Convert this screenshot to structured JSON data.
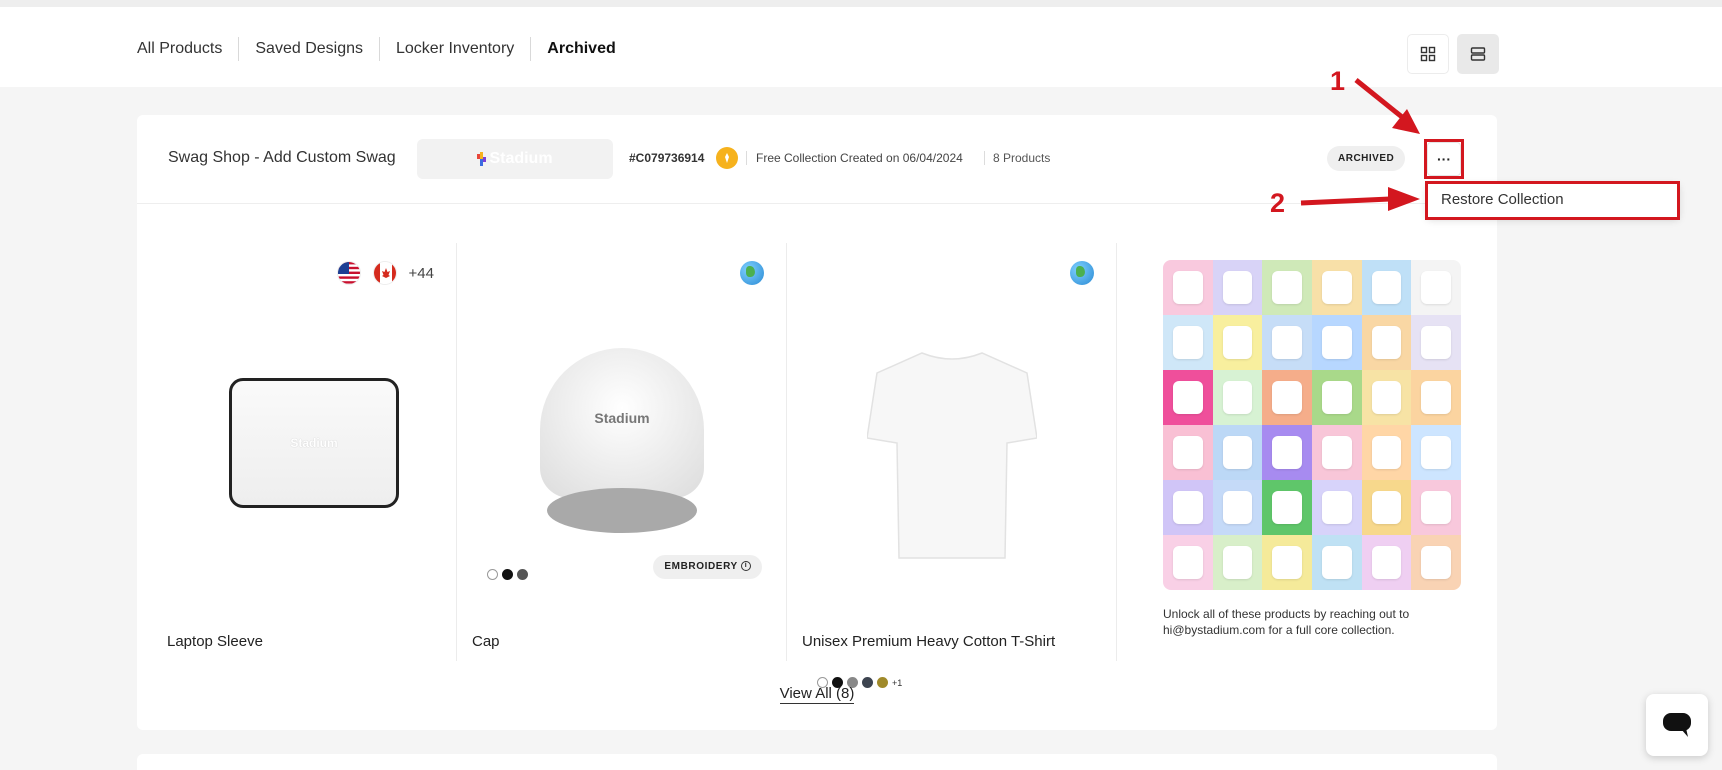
{
  "tabs": [
    "All Products",
    "Saved Designs",
    "Locker Inventory",
    "Archived"
  ],
  "active_tab": "Archived",
  "view_toggle": {
    "grid_icon": "grid-view-icon",
    "list_icon": "list-view-icon",
    "active": "list"
  },
  "collection": {
    "title": "Swag Shop - Add Custom Swag",
    "logo_text": "Stadium",
    "id": "#C079736914",
    "meta": "Free Collection Created on 06/04/2024",
    "product_count": "8 Products",
    "status": "ARCHIVED",
    "more_label": "···"
  },
  "menu": {
    "restore": "Restore Collection"
  },
  "annotations": {
    "step1": "1",
    "step2": "2",
    "color": "#d3171f"
  },
  "products": [
    {
      "name": "Laptop Sleeve",
      "logo_text": "Stadium",
      "regions_extra": "+44",
      "flags": [
        "us-flag-icon",
        "canada-flag-icon"
      ]
    },
    {
      "name": "Cap",
      "logo_text": "Stadium",
      "badge": "EMBROIDERY",
      "colors": [
        "#ffffff",
        "#111111",
        "#555555"
      ]
    },
    {
      "name": "Unisex Premium Heavy Cotton T-Shirt",
      "colors": [
        "#ffffff",
        "#111111",
        "#888888",
        "#3d4450",
        "#a08a2a"
      ],
      "colors_more": "+1"
    }
  ],
  "collage_note": "Unlock all of these products by reaching out to hi@bystadium.com for a full core collection.",
  "view_all": "View All (8)",
  "chat_icon": "chat-icon"
}
